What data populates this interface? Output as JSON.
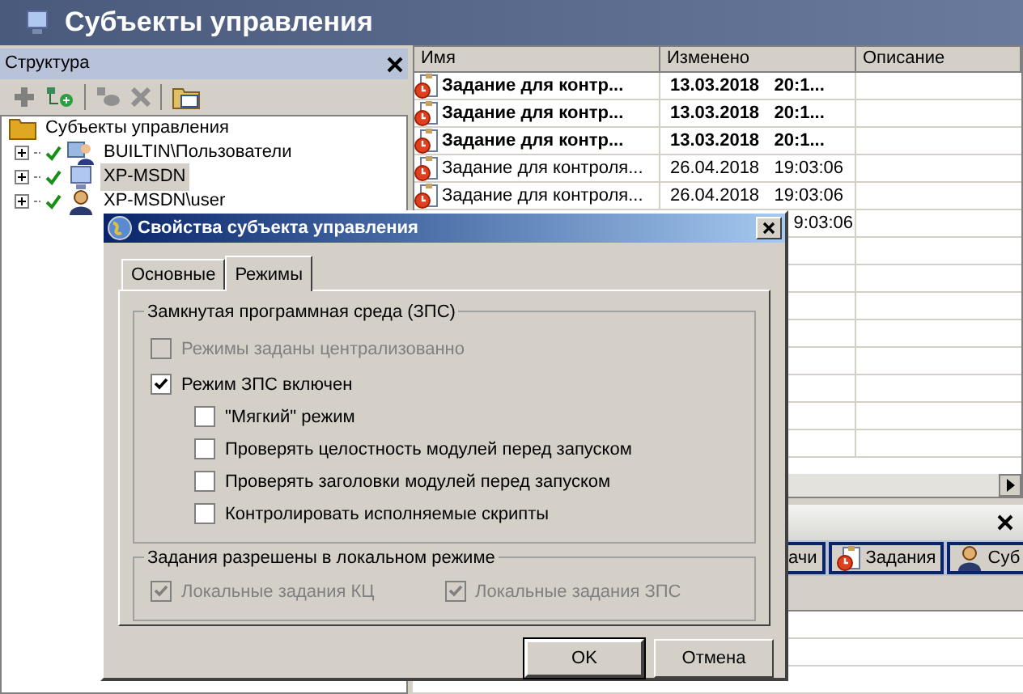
{
  "app": {
    "title": "Субъекты управления"
  },
  "structure_panel": {
    "title": "Структура",
    "tree": [
      {
        "label": "Субъекты управления",
        "selected": false,
        "children": [
          {
            "label": "BUILTIN\\Пользователи",
            "selected": false,
            "checked": true,
            "kind": "group"
          },
          {
            "label": "XP-MSDN",
            "selected": true,
            "checked": true,
            "kind": "computer"
          },
          {
            "label": "XP-MSDN\\user",
            "selected": false,
            "checked": true,
            "kind": "user"
          }
        ]
      }
    ]
  },
  "table": {
    "columns": [
      "Имя",
      "Изменено",
      "Описание"
    ],
    "rows": [
      {
        "name": "Задание для контр...",
        "modified": "13.03.2018   20:1...",
        "bold": true
      },
      {
        "name": "Задание для контр...",
        "modified": "13.03.2018   20:1...",
        "bold": true
      },
      {
        "name": "Задание для контр...",
        "modified": "13.03.2018   20:1...",
        "bold": true
      },
      {
        "name": "Задание для контроля...",
        "modified": "26.04.2018   19:03:06",
        "bold": false
      },
      {
        "name": "Задание для контроля...",
        "modified": "26.04.2018   19:03:06",
        "bold": false
      },
      {
        "modified": "9:03:06",
        "bold": false
      }
    ]
  },
  "bottom_panel": {
    "tabs": [
      {
        "label": "ачи",
        "selected": false,
        "kind": "plain"
      },
      {
        "label": "Задания",
        "selected": false,
        "kind": "task"
      },
      {
        "label": "Суб",
        "selected": false,
        "kind": "subject"
      }
    ]
  },
  "dialog": {
    "title": "Свойства субъекта управления",
    "tabs": [
      {
        "label": "Основные",
        "selected": false
      },
      {
        "label": "Режимы",
        "selected": true
      }
    ],
    "groups": [
      {
        "title": "Замкнутая программная среда (ЗПС)",
        "kind": "column",
        "options": [
          {
            "label": "Режимы заданы централизованно",
            "checked": false,
            "disabled": true
          },
          {
            "label": "Режим ЗПС включен",
            "checked": true,
            "disabled": false,
            "children": [
              {
                "label": "\"Мягкий\" режим",
                "checked": false,
                "disabled": false
              },
              {
                "label": "Проверять целостность модулей перед запуском",
                "checked": false,
                "disabled": false
              },
              {
                "label": "Проверять заголовки модулей перед запуском",
                "checked": false,
                "disabled": false
              },
              {
                "label": "Контролировать исполняемые скрипты",
                "checked": false,
                "disabled": false
              }
            ]
          }
        ]
      },
      {
        "title": "Задания разрешены в локальном режиме",
        "kind": "row",
        "options": [
          {
            "label": "Локальные задания КЦ",
            "checked": true,
            "disabled": true
          },
          {
            "label": "Локальные задания ЗПС",
            "checked": true,
            "disabled": true
          }
        ]
      }
    ],
    "buttons": [
      {
        "label": "OK",
        "default": true
      },
      {
        "label": "Отмена",
        "default": false
      }
    ]
  }
}
